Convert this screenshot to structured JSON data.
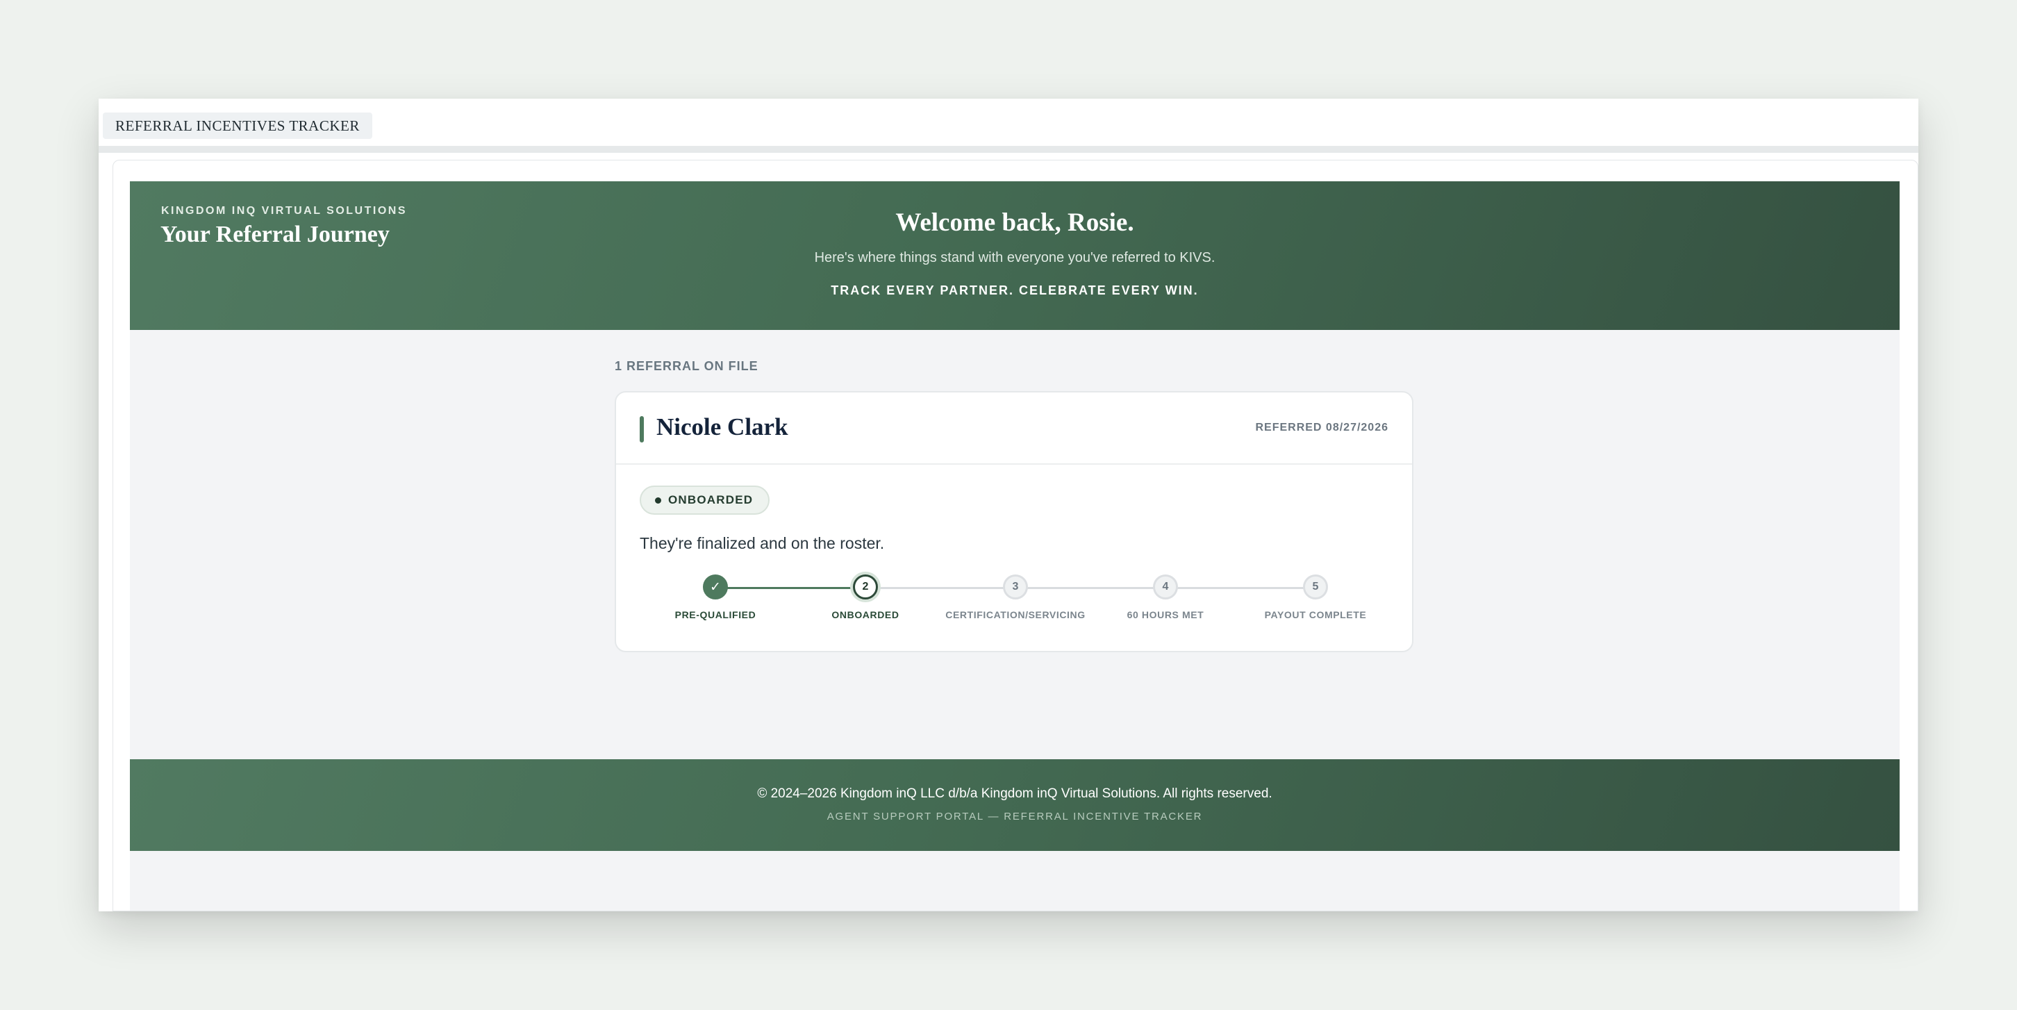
{
  "tab": {
    "label": "REFERRAL INCENTIVES TRACKER"
  },
  "header": {
    "brand_small": "KINGDOM INQ VIRTUAL SOLUTIONS",
    "brand_title": "Your Referral Journey",
    "welcome": "Welcome back, Rosie.",
    "subtext": "Here's where things stand with everyone you've referred to KIVS.",
    "tagline": "TRACK EVERY PARTNER. CELEBRATE EVERY WIN."
  },
  "main": {
    "section_label": "1 REFERRAL ON FILE",
    "referral": {
      "name": "Nicole Clark",
      "referred": "REFERRED 08/27/2026",
      "status_badge": "ONBOARDED",
      "status_text": "They're finalized and on the roster.",
      "progress": {
        "completed_steps": 1,
        "current_step": 2,
        "total_steps": 5
      },
      "steps": [
        {
          "marker": "✓",
          "label": "PRE-QUALIFIED",
          "state": "done"
        },
        {
          "marker": "2",
          "label": "ONBOARDED",
          "state": "current"
        },
        {
          "marker": "3",
          "label": "CERTIFICATION/SERVICING",
          "state": "pending"
        },
        {
          "marker": "4",
          "label": "60 HOURS MET",
          "state": "pending"
        },
        {
          "marker": "5",
          "label": "PAYOUT COMPLETE",
          "state": "pending"
        }
      ]
    }
  },
  "footer": {
    "copyright": "© 2024–2026 Kingdom inQ LLC d/b/a Kingdom inQ Virtual Solutions. All rights reserved.",
    "sub": "AGENT SUPPORT PORTAL — REFERRAL INCENTIVE TRACKER"
  },
  "colors": {
    "brand_green": "#4e7a5e",
    "brand_green_dark": "#355141",
    "background": "#f3f4f6",
    "heading": "#14233a"
  }
}
